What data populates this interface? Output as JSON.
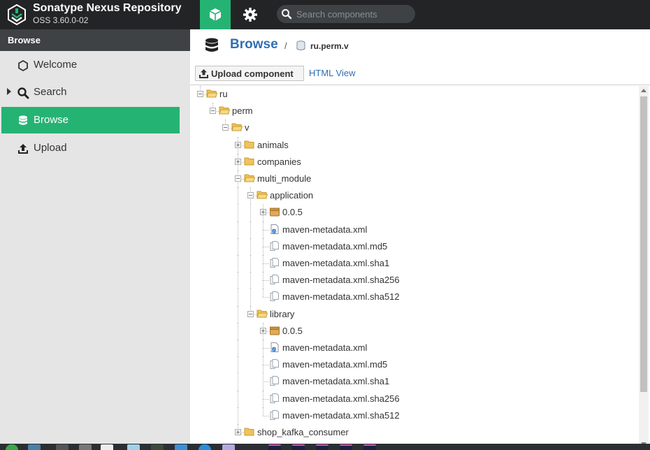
{
  "header": {
    "app_name": "Sonatype Nexus Repository",
    "version": "OSS 3.60.0-02",
    "search_placeholder": "Search components",
    "browse_icon": "cube-icon",
    "settings_icon": "gear-icon",
    "accent": "#25b374"
  },
  "sidebar": {
    "heading": "Browse",
    "items": [
      {
        "label": "Welcome",
        "icon": "hexagon-icon"
      },
      {
        "label": "Search",
        "icon": "search-icon"
      },
      {
        "label": "Browse",
        "icon": "database-icon"
      },
      {
        "label": "Upload",
        "icon": "upload-icon"
      }
    ]
  },
  "breadcrumb": {
    "title": "Browse",
    "separator": "/",
    "path": "ru.perm.v"
  },
  "toolbar": {
    "upload_label": "Upload component",
    "html_view_label": "HTML View"
  },
  "tree": [
    {
      "label": "ru",
      "type": "folder",
      "depth": 0,
      "expanded": true
    },
    {
      "label": "perm",
      "type": "folder",
      "depth": 1,
      "expanded": true
    },
    {
      "label": "v",
      "type": "folder",
      "depth": 2,
      "expanded": true
    },
    {
      "label": "animals",
      "type": "folder",
      "depth": 3,
      "expanded": false
    },
    {
      "label": "companies",
      "type": "folder",
      "depth": 3,
      "expanded": false
    },
    {
      "label": "multi_module",
      "type": "folder",
      "depth": 3,
      "expanded": true
    },
    {
      "label": "application",
      "type": "folder",
      "depth": 4,
      "expanded": true
    },
    {
      "label": "0.0.5",
      "type": "component",
      "depth": 5,
      "expanded": false
    },
    {
      "label": "maven-metadata.xml",
      "type": "xml",
      "depth": 5
    },
    {
      "label": "maven-metadata.xml.md5",
      "type": "file",
      "depth": 5
    },
    {
      "label": "maven-metadata.xml.sha1",
      "type": "file",
      "depth": 5
    },
    {
      "label": "maven-metadata.xml.sha256",
      "type": "file",
      "depth": 5
    },
    {
      "label": "maven-metadata.xml.sha512",
      "type": "file",
      "depth": 5
    },
    {
      "label": "library",
      "type": "folder",
      "depth": 4,
      "expanded": true
    },
    {
      "label": "0.0.5",
      "type": "component",
      "depth": 5,
      "expanded": false
    },
    {
      "label": "maven-metadata.xml",
      "type": "xml",
      "depth": 5
    },
    {
      "label": "maven-metadata.xml.md5",
      "type": "file",
      "depth": 5
    },
    {
      "label": "maven-metadata.xml.sha1",
      "type": "file",
      "depth": 5
    },
    {
      "label": "maven-metadata.xml.sha256",
      "type": "file",
      "depth": 5
    },
    {
      "label": "maven-metadata.xml.sha512",
      "type": "file",
      "depth": 5
    },
    {
      "label": "shop_kafka_consumer",
      "type": "folder",
      "depth": 3,
      "expanded": false
    }
  ]
}
